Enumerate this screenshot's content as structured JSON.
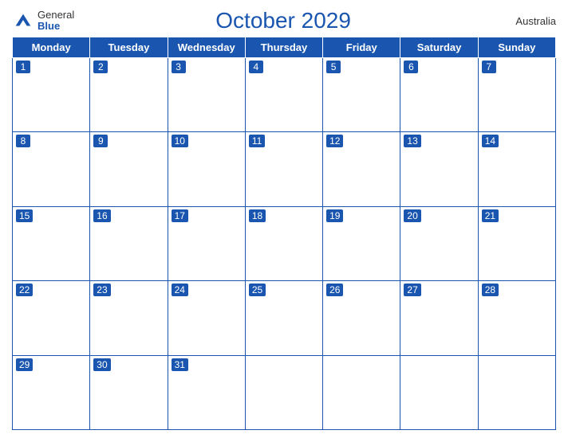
{
  "logo": {
    "general": "General",
    "blue": "Blue"
  },
  "header": {
    "title": "October 2029",
    "country": "Australia"
  },
  "weekdays": [
    "Monday",
    "Tuesday",
    "Wednesday",
    "Thursday",
    "Friday",
    "Saturday",
    "Sunday"
  ],
  "weeks": [
    [
      1,
      2,
      3,
      4,
      5,
      6,
      7
    ],
    [
      8,
      9,
      10,
      11,
      12,
      13,
      14
    ],
    [
      15,
      16,
      17,
      18,
      19,
      20,
      21
    ],
    [
      22,
      23,
      24,
      25,
      26,
      27,
      28
    ],
    [
      29,
      30,
      31,
      null,
      null,
      null,
      null
    ]
  ]
}
